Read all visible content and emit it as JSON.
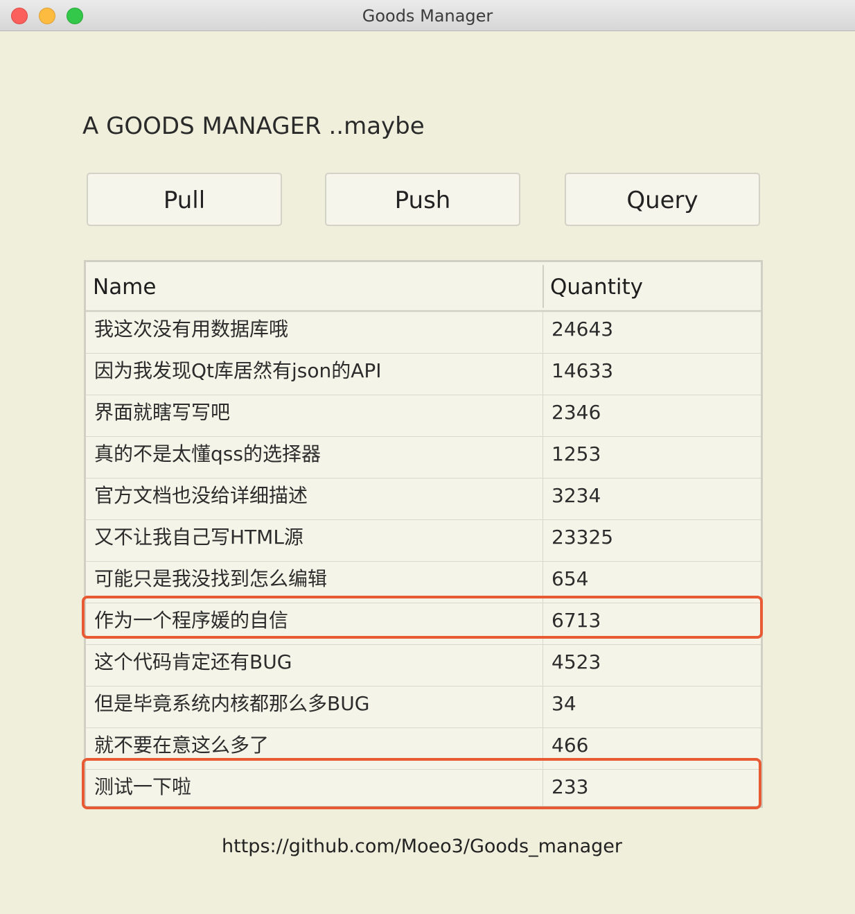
{
  "window": {
    "title": "Goods Manager"
  },
  "heading": "A GOODS MANAGER ..maybe",
  "buttons": {
    "pull": "Pull",
    "push": "Push",
    "query": "Query"
  },
  "table": {
    "columns": [
      "Name",
      "Quantity"
    ],
    "rows": [
      {
        "name": "我这次没有用数据库哦",
        "quantity": "24643"
      },
      {
        "name": "因为我发现Qt库居然有json的API",
        "quantity": "14633"
      },
      {
        "name": "界面就瞎写写吧",
        "quantity": "2346"
      },
      {
        "name": "真的不是太懂qss的选择器",
        "quantity": "1253"
      },
      {
        "name": "官方文档也没给详细描述",
        "quantity": "3234"
      },
      {
        "name": "又不让我自己写HTML源",
        "quantity": "23325"
      },
      {
        "name": "可能只是我没找到怎么编辑",
        "quantity": "654"
      },
      {
        "name": "作为一个程序媛的自信",
        "quantity": "6713"
      },
      {
        "name": "这个代码肯定还有BUG",
        "quantity": "4523"
      },
      {
        "name": "但是毕竟系统内核都那么多BUG",
        "quantity": "34"
      },
      {
        "name": "就不要在意这么多了",
        "quantity": "466"
      },
      {
        "name": "测试一下啦",
        "quantity": "233"
      }
    ],
    "highlighted_rows": [
      "作为一个程序媛的自信",
      "测试一下啦"
    ]
  },
  "footer": {
    "link": "https://github.com/Moeo3/Goods_manager"
  },
  "colors": {
    "window_bg": "#efefdc",
    "highlight": "#e85a33"
  }
}
